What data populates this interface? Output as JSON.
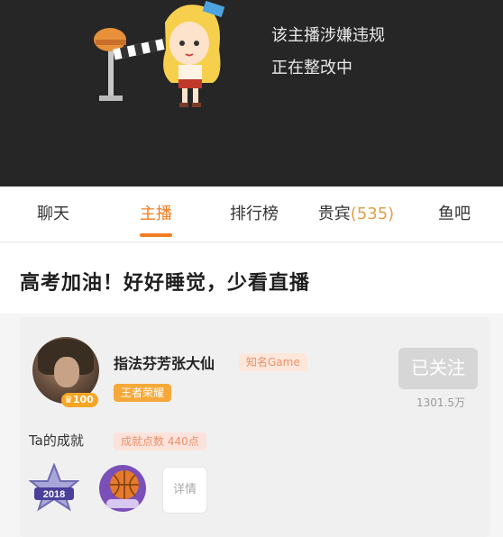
{
  "banner": {
    "line1": "该主播涉嫌违规",
    "line2": "正在整改中"
  },
  "tabs": [
    {
      "label": "聊天"
    },
    {
      "label": "主播",
      "active": true
    },
    {
      "label": "排行榜"
    },
    {
      "label": "贵宾",
      "count": "(535)"
    },
    {
      "label": "鱼吧"
    }
  ],
  "notice": "高考加油！好好睡觉，少看直播",
  "streamer": {
    "name": "指法芬芳张大仙",
    "category": "知名Game",
    "level": "100",
    "title": "王者荣耀",
    "follow_label": "已关注",
    "fans": "1301.5万"
  },
  "achievements": {
    "label": "Ta的成就",
    "score": "成就点数 440点",
    "medals": [
      {
        "icon": "star-medal-2018-icon",
        "text": "2018"
      },
      {
        "icon": "basketball-medal-icon"
      }
    ],
    "detail_label": "详情"
  },
  "colors": {
    "accent": "#f07d22",
    "banner_bg": "#262626",
    "follow_bg": "#d6d6d6"
  }
}
